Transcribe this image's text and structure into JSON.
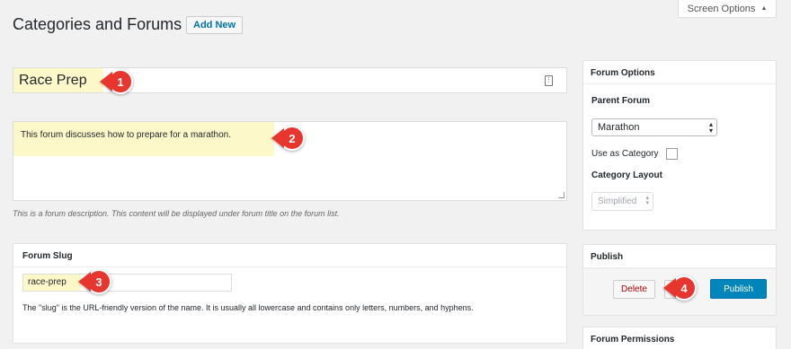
{
  "header": {
    "title": "Categories and Forums",
    "add_new_label": "Add New",
    "screen_options_label": "Screen Options"
  },
  "form": {
    "title_value": "Race Prep",
    "description_value": "This forum discusses how to prepare for a marathon.",
    "description_note": "This is a forum description. This content will be displayed under forum title on the forum list."
  },
  "slug": {
    "heading": "Forum Slug",
    "value": "race-prep",
    "note": "The \"slug\" is the URL-friendly version of the name. It is usually all lowercase and contains only letters, numbers, and hyphens."
  },
  "forum_options": {
    "heading": "Forum Options",
    "parent_label": "Parent Forum",
    "parent_value": "Marathon",
    "use_as_category_label": "Use as Category",
    "layout_label": "Category Layout",
    "layout_value": "Simplified"
  },
  "publish_panel": {
    "heading": "Publish",
    "delete_label": "Delete",
    "publish_label": "Publish"
  },
  "permissions_panel": {
    "heading": "Forum Permissions"
  },
  "callouts": [
    "1",
    "2",
    "3",
    "4"
  ],
  "colors": {
    "highlight": "#fdf8c9",
    "callout": "#e8362f",
    "primary": "#0085ba",
    "link": "#0073aa"
  }
}
